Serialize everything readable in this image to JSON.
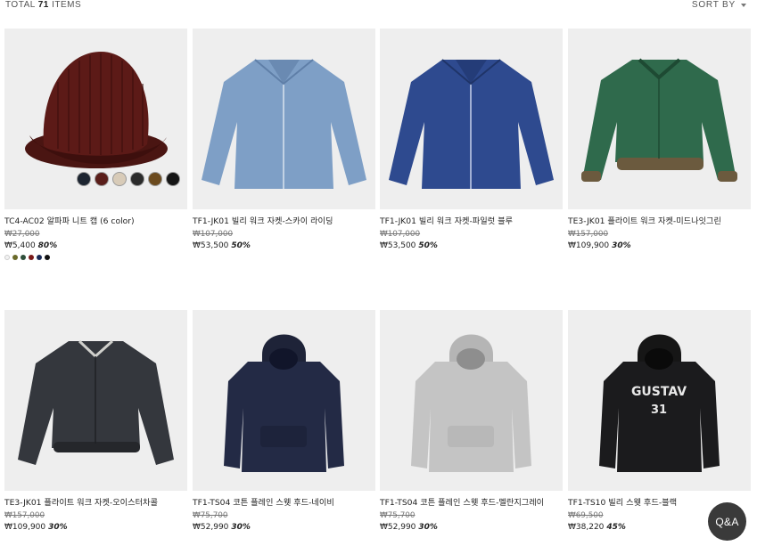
{
  "header": {
    "total_prefix": "TOTAL",
    "total_count": "71",
    "total_suffix": "ITEMS",
    "sort_label": "SORT BY"
  },
  "products": [
    {
      "name": "TC4-AC02 알파파 니트 캡 (6 color)",
      "original": "₩27,000",
      "sale": "₩5,400",
      "discount": "80%",
      "swatches": [
        "#f2f2f2",
        "#6b6b2a",
        "#2f4f3a",
        "#7a1a1a",
        "#1a2a55",
        "#111111"
      ],
      "chips": [
        "#1c2430",
        "#5a1e1a",
        "#d8cbb8",
        "#2b2b2b",
        "#6b4a1e",
        "#151515"
      ]
    },
    {
      "name": "TF1-JK01 빌리 워크 자켓-스카이 라이딩",
      "original": "₩107,000",
      "sale": "₩53,500",
      "discount": "50%"
    },
    {
      "name": "TF1-JK01 빌리 워크 자켓-파일럿 블루",
      "original": "₩107,000",
      "sale": "₩53,500",
      "discount": "50%"
    },
    {
      "name": "TE3-JK01 플라이트 워크 자켓-미드나잇그린",
      "original": "₩157,000",
      "sale": "₩109,900",
      "discount": "30%"
    },
    {
      "name": "TE3-JK01 플라이트 워크 자켓-오이스터차콜",
      "original": "₩157,000",
      "sale": "₩109,900",
      "discount": "30%"
    },
    {
      "name": "TF1-TS04 코튼 플레인 스웻 후드-네이비",
      "original": "₩75,700",
      "sale": "₩52,990",
      "discount": "30%"
    },
    {
      "name": "TF1-TS04 코튼 플레인 스웻 후드-멜란지그레이",
      "original": "₩75,700",
      "sale": "₩52,990",
      "discount": "30%"
    },
    {
      "name": "TF1-TS10 빌리 스웻 후드-블랙",
      "original": "₩69,500",
      "sale": "₩38,220",
      "discount": "45%",
      "print_line1": "GUSTAV",
      "print_line2": "31"
    }
  ],
  "qa_button": "Q&A",
  "colors": {
    "thumb_bg": "#eeeeee",
    "text": "#222222",
    "muted": "#777777"
  }
}
